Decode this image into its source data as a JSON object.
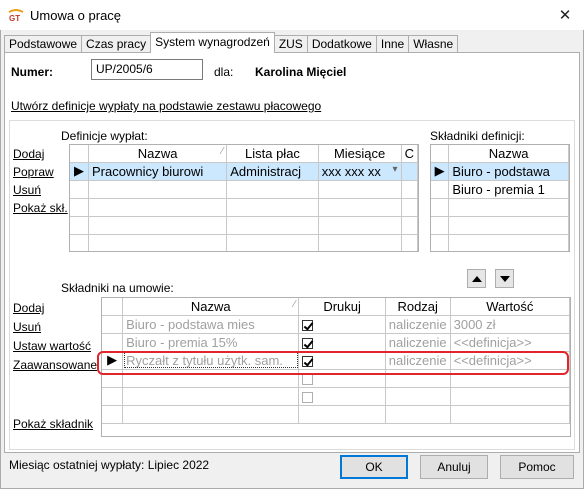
{
  "window": {
    "title": "Umowa o pracę",
    "close_glyph": "✕",
    "app_icon": "gt-app-icon",
    "close_icon": "close-icon"
  },
  "tabs": [
    "Podstawowe",
    "Czas pracy",
    "System wynagrodzeń",
    "ZUS",
    "Dodatkowe",
    "Inne",
    "Własne"
  ],
  "active_tab": "System wynagrodzeń",
  "header": {
    "numer_label": "Numer:",
    "numer_value": "UP/2005/6",
    "dla_label": "dla:",
    "employee": "Karolina Mięciel"
  },
  "create_link": "Utwórz definicje wypłaty na podstawie zestawu płacowego",
  "definitions": {
    "title": "Definicje wypłat:",
    "actions": [
      "Dodaj",
      "Popraw",
      "Usuń",
      "Pokaż skł."
    ],
    "columns": [
      "Nazwa",
      "Lista płac",
      "Miesiące",
      "C"
    ],
    "rows": [
      {
        "nazwa": "Pracownicy biurowi",
        "lista": "Administracj",
        "miesiace": "xxx xxx xx"
      }
    ]
  },
  "components_def": {
    "title": "Składniki definicji:",
    "columns": [
      "Nazwa"
    ],
    "rows": [
      "Biuro - podstawa",
      "Biuro - premia 1"
    ]
  },
  "agreement": {
    "title": "Składniki na umowie:",
    "actions": [
      "Dodaj",
      "Usuń",
      "Ustaw wartość",
      "Zaawansowane"
    ],
    "show_link": "Pokaż składnik",
    "columns": [
      "Nazwa",
      "Drukuj",
      "Rodzaj",
      "Wartość"
    ],
    "rows": [
      {
        "nazwa": "Biuro - podstawa mies",
        "drukuj": true,
        "rodzaj": "naliczenie",
        "wartosc": "3000 zł"
      },
      {
        "nazwa": "Biuro - premia 15%",
        "drukuj": true,
        "rodzaj": "naliczenie",
        "wartosc": "<<definicja>>"
      },
      {
        "nazwa": "Ryczałt z tytułu użytk. sam.",
        "drukuj": true,
        "rodzaj": "naliczenie",
        "wartosc": "<<definicja>>"
      }
    ]
  },
  "status": "Miesiąc ostatniej wypłaty: Lipiec 2022",
  "buttons": {
    "ok": "OK",
    "anuluj": "Anuluj",
    "pomoc": "Pomoc"
  },
  "highlight_color": "#e0262c",
  "selection_color": "#cce8ff"
}
